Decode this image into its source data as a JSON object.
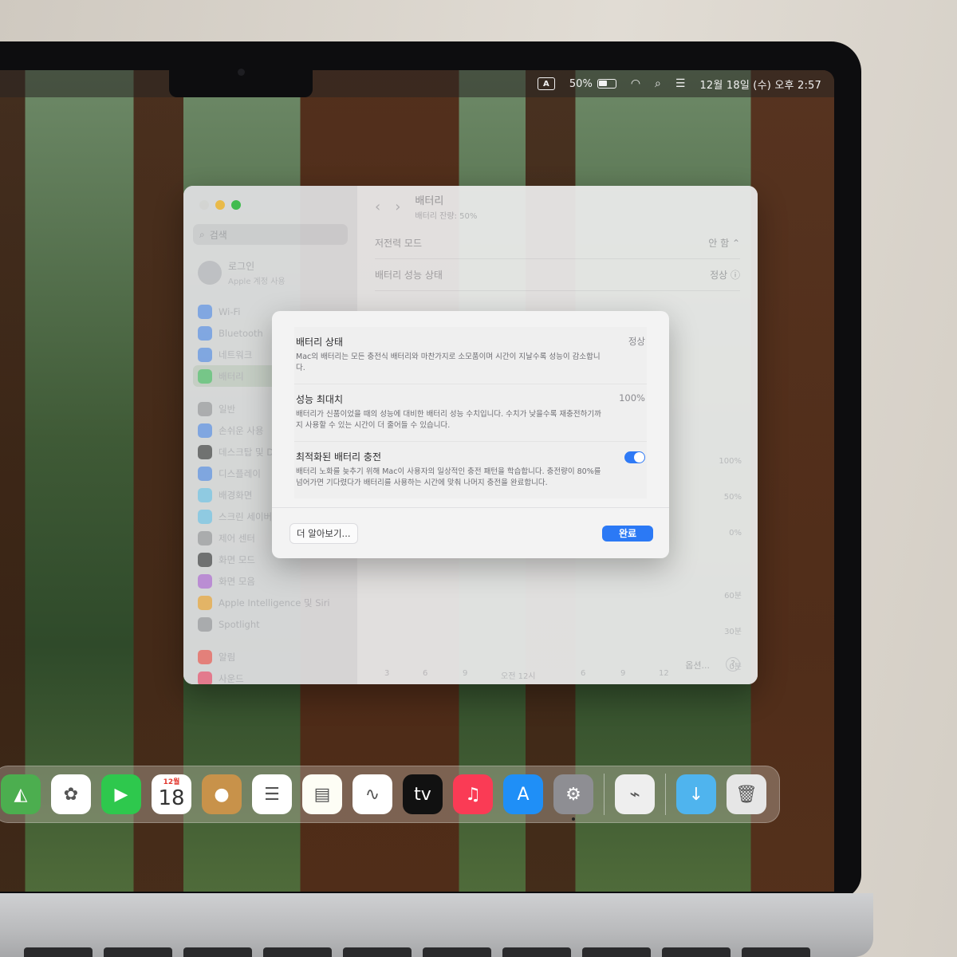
{
  "menubar": {
    "input_indicator": "A",
    "battery_percent": "50%",
    "battery_level": 0.5,
    "icons": [
      "input-source-icon",
      "battery-icon",
      "wifi-icon",
      "spotlight-search-icon",
      "control-center-icon"
    ],
    "clock": "12월 18일 (수) 오후 2:57"
  },
  "settings": {
    "sidebar": {
      "search_placeholder": "검색",
      "account_title": "로그인",
      "account_subtitle": "Apple 계정 사용",
      "items": [
        {
          "label": "Wi-Fi",
          "icon": "wifi-icon",
          "color": "#3b82f6"
        },
        {
          "label": "Bluetooth",
          "icon": "bluetooth-icon",
          "color": "#3b82f6"
        },
        {
          "label": "네트워크",
          "icon": "globe-icon",
          "color": "#3b82f6"
        },
        {
          "label": "배터리",
          "icon": "battery-icon",
          "color": "#34c759",
          "selected": true
        },
        {
          "label": "일반",
          "icon": "gear-icon",
          "color": "#8e8e93"
        },
        {
          "label": "손쉬운 사용",
          "icon": "accessibility-icon",
          "color": "#3b82f6"
        },
        {
          "label": "데스크탑 및 Dock",
          "icon": "dock-icon",
          "color": "#1c1c1e"
        },
        {
          "label": "디스플레이",
          "icon": "display-icon",
          "color": "#3b82f6"
        },
        {
          "label": "배경화면",
          "icon": "wallpaper-icon",
          "color": "#5ac8fa"
        },
        {
          "label": "스크린 세이버",
          "icon": "screensaver-icon",
          "color": "#5ac8fa"
        },
        {
          "label": "제어 센터",
          "icon": "control-center-icon",
          "color": "#8e8e93"
        },
        {
          "label": "화면 모드",
          "icon": "appearance-icon",
          "color": "#1c1c1e"
        },
        {
          "label": "화면 모음",
          "icon": "siri-icon",
          "color": "#af52de"
        },
        {
          "label": "Apple Intelligence 및 Siri",
          "icon": "siri-icon",
          "color": "#ff9f0a"
        },
        {
          "label": "Spotlight",
          "icon": "spotlight-icon",
          "color": "#8e8e93"
        },
        {
          "label": "알림",
          "icon": "bell-icon",
          "color": "#ff3b30"
        },
        {
          "label": "사운드",
          "icon": "sound-icon",
          "color": "#ff2d55"
        }
      ]
    },
    "content": {
      "title": "배터리",
      "subtitle": "배터리 잔량: 50%",
      "rows": [
        {
          "label": "저전력 모드",
          "value": "안 함 ⌃"
        },
        {
          "label": "배터리 성능 상태",
          "value": "정상"
        }
      ],
      "chart": {
        "y_labels": [
          "100%",
          "50%",
          "0%",
          "60분",
          "30분",
          "0분"
        ],
        "x_labels": [
          "3",
          "6",
          "9",
          "오전 12시",
          "6",
          "9",
          "12"
        ],
        "x_dates": [
          "12월 17일",
          "12월 18일"
        ]
      },
      "footer_button": "옵션...",
      "help": "?"
    }
  },
  "sheet": {
    "sections": [
      {
        "title": "배터리 상태",
        "value": "정상",
        "description": "Mac의 배터리는 모든 충전식 배터리와 마찬가지로 소모품이며 시간이 지날수록 성능이 감소합니다."
      },
      {
        "title": "성능 최대치",
        "value": "100%",
        "description": "배터리가 신품이었을 때의 성능에 대비한 배터리 성능 수치입니다. 수치가 낮을수록 재충전하기까지 사용할 수 있는 시간이 더 줄어들 수 있습니다."
      },
      {
        "title": "최적화된 배터리 충전",
        "toggle_on": true,
        "description": "배터리 노화를 늦추기 위해 Mac이 사용자의 일상적인 충전 패턴을 학습합니다. 충전량이 80%를 넘어가면 기다렸다가 배터리를 사용하는 시간에 맞춰 나머지 충전을 완료합니다."
      }
    ],
    "learn_more": "더 알아보기...",
    "done": "완료"
  },
  "dock": {
    "apps": [
      {
        "name": "maps-icon",
        "color": "#4cae4f",
        "glyph": "◭"
      },
      {
        "name": "photos-icon",
        "color": "#ffffff",
        "glyph": "✿"
      },
      {
        "name": "facetime-icon",
        "color": "#2ec84d",
        "glyph": "▶"
      },
      {
        "name": "calendar-icon",
        "color": "#ffffff",
        "month": "12월",
        "day": "18"
      },
      {
        "name": "contacts-icon",
        "color": "#c8924a",
        "glyph": "●"
      },
      {
        "name": "reminders-icon",
        "color": "#ffffff",
        "glyph": "☰"
      },
      {
        "name": "notes-icon",
        "color": "#fdfdf5",
        "glyph": "▤"
      },
      {
        "name": "freeform-icon",
        "color": "#ffffff",
        "glyph": "∿"
      },
      {
        "name": "apple-tv-icon",
        "color": "#111111",
        "glyph": "tv"
      },
      {
        "name": "music-icon",
        "color": "#fa3b55",
        "glyph": "♫"
      },
      {
        "name": "app-store-icon",
        "color": "#1f8ff7",
        "glyph": "A"
      },
      {
        "name": "system-settings-icon",
        "color": "#8e8e93",
        "glyph": "⚙"
      },
      {
        "name": "utility-app-icon",
        "color": "#eeeeee",
        "glyph": "⌁"
      },
      {
        "name": "downloads-folder-icon",
        "color": "#4fb4ee",
        "glyph": "↓"
      },
      {
        "name": "trash-icon",
        "color": "#e6e6e6",
        "glyph": "🗑"
      }
    ]
  }
}
